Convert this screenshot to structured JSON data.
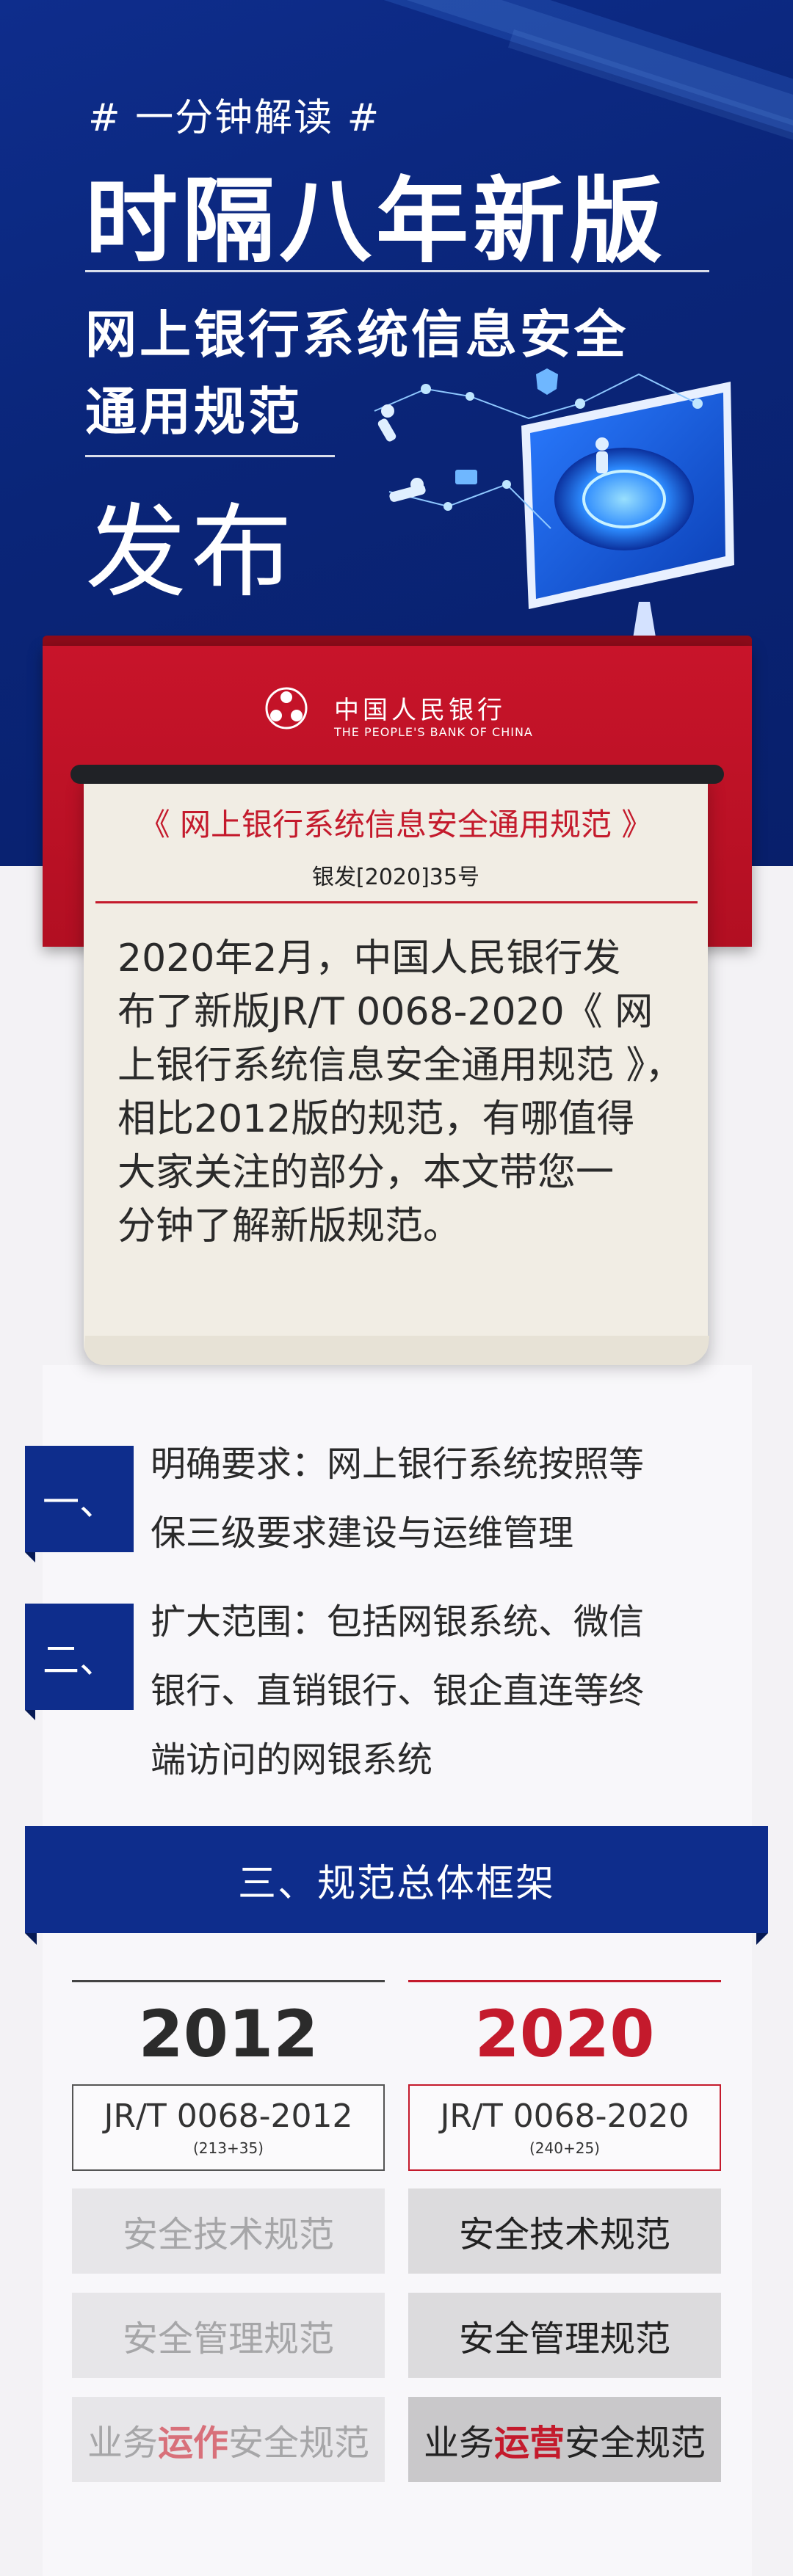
{
  "hero": {
    "hashtag": "# 一分钟解读 #",
    "title": "时隔八年新版",
    "subtitle_line1": "网上银行系统信息安全",
    "subtitle_line2": "通用规范",
    "big_word": "发布"
  },
  "pboc": {
    "name_cn": "中国人民银行",
    "name_en": "THE PEOPLE'S BANK OF CHINA"
  },
  "document": {
    "title": "《 网上银行系统信息安全通用规范 》",
    "number": "银发[2020]35号",
    "body_lines": [
      "2020年2月，中国人民银行发",
      "布了新版JR/T 0068-2020《 网",
      "上银行系统信息安全通用规范 》，",
      "相比2012版的规范，有哪值得",
      "大家关注的部分，本文带您一",
      "分钟了解新版规范。"
    ]
  },
  "points": [
    {
      "badge": "一、",
      "lines": [
        "明确要求：网上银行系统按照等",
        "保三级要求建设与运维管理"
      ]
    },
    {
      "badge": "二、",
      "lines": [
        "扩大范围：包括网银系统、微信",
        "银行、直销银行、银企直连等终",
        "端访问的网银系统"
      ]
    }
  ],
  "section_header": "三、规范总体框架",
  "comparison": {
    "old": {
      "year": "2012",
      "code": "JR/T 0068-2012",
      "code_sub": "(213+35)",
      "items": [
        "安全技术规范",
        "安全管理规范"
      ],
      "last_pre": "业务",
      "last_hl": "运作",
      "last_post": "安全规范"
    },
    "new": {
      "year": "2020",
      "code": "JR/T 0068-2020",
      "code_sub": "(240+25)",
      "items": [
        "安全技术规范",
        "安全管理规范"
      ],
      "last_pre": "业务",
      "last_hl": "运营",
      "last_post": "安全规范"
    }
  },
  "colors": {
    "navy": "#0e2d8c",
    "red": "#c41a2c",
    "paper": "#f1ede4",
    "old_year": "#2b2b2b"
  }
}
